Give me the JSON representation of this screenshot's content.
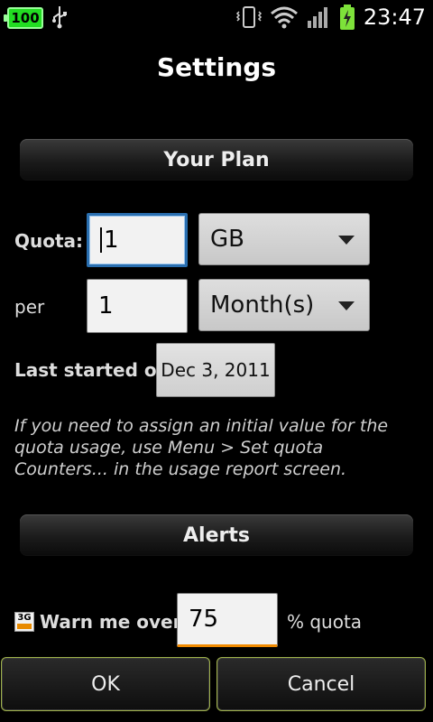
{
  "status_bar": {
    "battery_left_text": "100",
    "time": "23:47",
    "icons": [
      "usb-icon",
      "vibrate-icon",
      "wifi-icon",
      "signal-icon",
      "battery-charging-icon"
    ]
  },
  "title": "Settings",
  "plan": {
    "header": "Your Plan",
    "quota_label": "Quota:",
    "quota_value": "1",
    "quota_unit": "GB",
    "per_label": "per",
    "per_value": "1",
    "per_unit": "Month(s)",
    "last_started_label": "Last started on",
    "last_started_value": "Dec 3, 2011",
    "help_text": "If you need to assign an initial value for the quota usage, use Menu > Set quota Counters... in the usage report screen."
  },
  "alerts": {
    "header": "Alerts",
    "warn_label": "Warn me over",
    "warn_value": "75",
    "warn_suffix": "% quota",
    "icon_text": "3G"
  },
  "buttons": {
    "ok": "OK",
    "cancel": "Cancel"
  },
  "colors": {
    "focus_blue": "#2a6fb0",
    "accent_orange": "#f08a00",
    "battery_green": "#22dd22"
  }
}
